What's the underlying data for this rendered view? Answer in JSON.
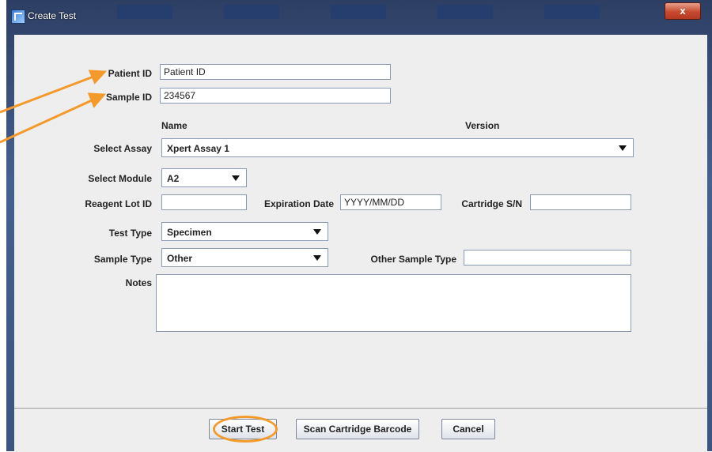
{
  "window": {
    "title": "Create Test",
    "close_symbol": "x",
    "icon": "app-icon"
  },
  "form": {
    "patient_id": {
      "label": "Patient ID",
      "value": "Patient ID"
    },
    "sample_id": {
      "label": "Sample ID",
      "value": "234567"
    },
    "column_headers": {
      "name": "Name",
      "version": "Version"
    },
    "select_assay": {
      "label": "Select Assay",
      "value": "Xpert Assay 1"
    },
    "select_module": {
      "label": "Select Module",
      "value": "A2"
    },
    "reagent_lot_id": {
      "label": "Reagent Lot ID",
      "value": ""
    },
    "expiration_date": {
      "label": "Expiration Date",
      "value": "YYYY/MM/DD"
    },
    "cartridge_sn": {
      "label": "Cartridge S/N",
      "value": ""
    },
    "test_type": {
      "label": "Test Type",
      "value": "Specimen"
    },
    "sample_type": {
      "label": "Sample Type",
      "value": "Other"
    },
    "other_sample_type": {
      "label": "Other Sample Type",
      "value": ""
    },
    "notes": {
      "label": "Notes",
      "value": ""
    }
  },
  "buttons": {
    "start_test": "Start Test",
    "scan_barcode": "Scan Cartridge Barcode",
    "cancel": "Cancel"
  },
  "colors": {
    "annotation": "#f39a2b",
    "dialog_bg": "#eeeeee",
    "titlebar": "#3b5480"
  }
}
